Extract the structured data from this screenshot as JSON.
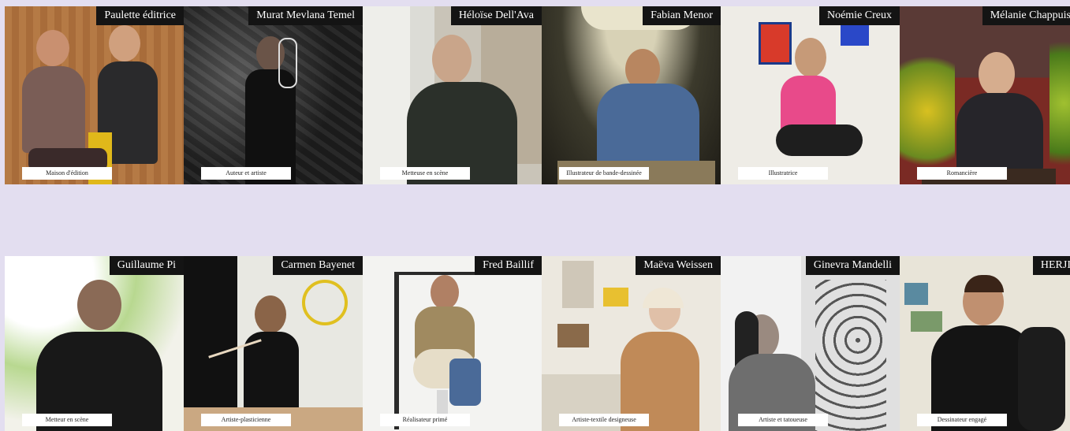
{
  "rows": [
    [
      {
        "name": "Paulette éditrice",
        "role": "Maison d'édition"
      },
      {
        "name": "Murat Mevlana Temel",
        "role": "Auteur et artiste"
      },
      {
        "name": "Héloïse Dell'Ava",
        "role": "Metteuse en scène"
      },
      {
        "name": "Fabian Menor",
        "role": "Illustrateur de bande-dessinée"
      },
      {
        "name": "Noémie Creux",
        "role": "Illustratrice"
      },
      {
        "name": "Mélanie Chappuis",
        "role": "Romancière"
      }
    ],
    [
      {
        "name": "Guillaume Pi",
        "role": "Metteur en scène"
      },
      {
        "name": "Carmen Bayenet",
        "role": "Artiste-plasticienne"
      },
      {
        "name": "Fred Baillif",
        "role": "Réalisateur primé"
      },
      {
        "name": "Maëva Weissen",
        "role": "Artiste-textile designeuse"
      },
      {
        "name": "Ginevra Mandelli",
        "role": "Artiste et tatoueuse"
      },
      {
        "name": "HERJI",
        "role": "Dessinateur engagé"
      }
    ]
  ]
}
